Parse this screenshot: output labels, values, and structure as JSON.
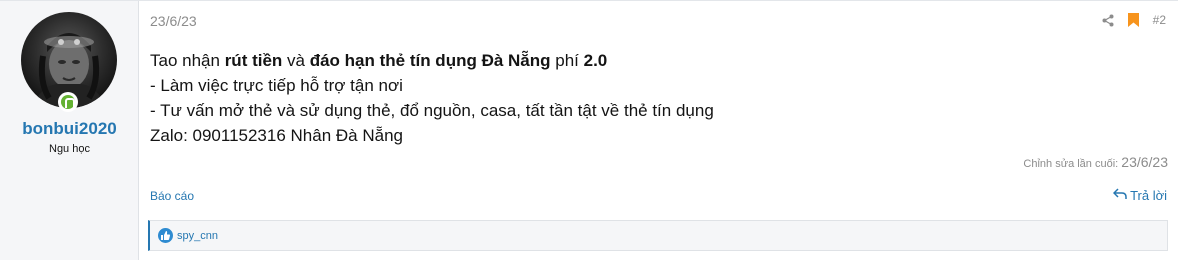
{
  "user": {
    "username": "bonbui2020",
    "title": "Ngu học",
    "online": true
  },
  "post": {
    "date": "23/6/23",
    "number": "#2",
    "message": {
      "line1": [
        {
          "text": "Tao nhận ",
          "bold": false
        },
        {
          "text": "rút tiền",
          "bold": true
        },
        {
          "text": " và ",
          "bold": false
        },
        {
          "text": "đáo hạn thẻ tín dụng Đà Nẵng",
          "bold": true
        },
        {
          "text": " phí ",
          "bold": false
        },
        {
          "text": "2.0",
          "bold": true
        }
      ],
      "line2": "- Làm việc trực tiếp hỗ trợ tận nơi",
      "line3": "- Tư vấn mở thẻ và sử dụng thẻ, đổ nguồn, casa, tất tần tật về thẻ tín dụng",
      "line4": "Zalo: 0901152316 Nhân Đà Nẵng"
    },
    "last_edited_label": "Chỉnh sửa lần cuối:",
    "last_edited_date": "23/6/23"
  },
  "actions": {
    "report": "Báo cáo",
    "reply": "Trả lời"
  },
  "reactions": {
    "users": "spy_cnn"
  },
  "icons": {
    "share": "share-icon",
    "bookmark": "bookmark-icon",
    "reply": "reply-icon",
    "like": "like-icon"
  },
  "colors": {
    "link": "#2577b1",
    "muted": "#8c8c8c",
    "bookmark": "#f7941d",
    "online": "#63b132"
  }
}
